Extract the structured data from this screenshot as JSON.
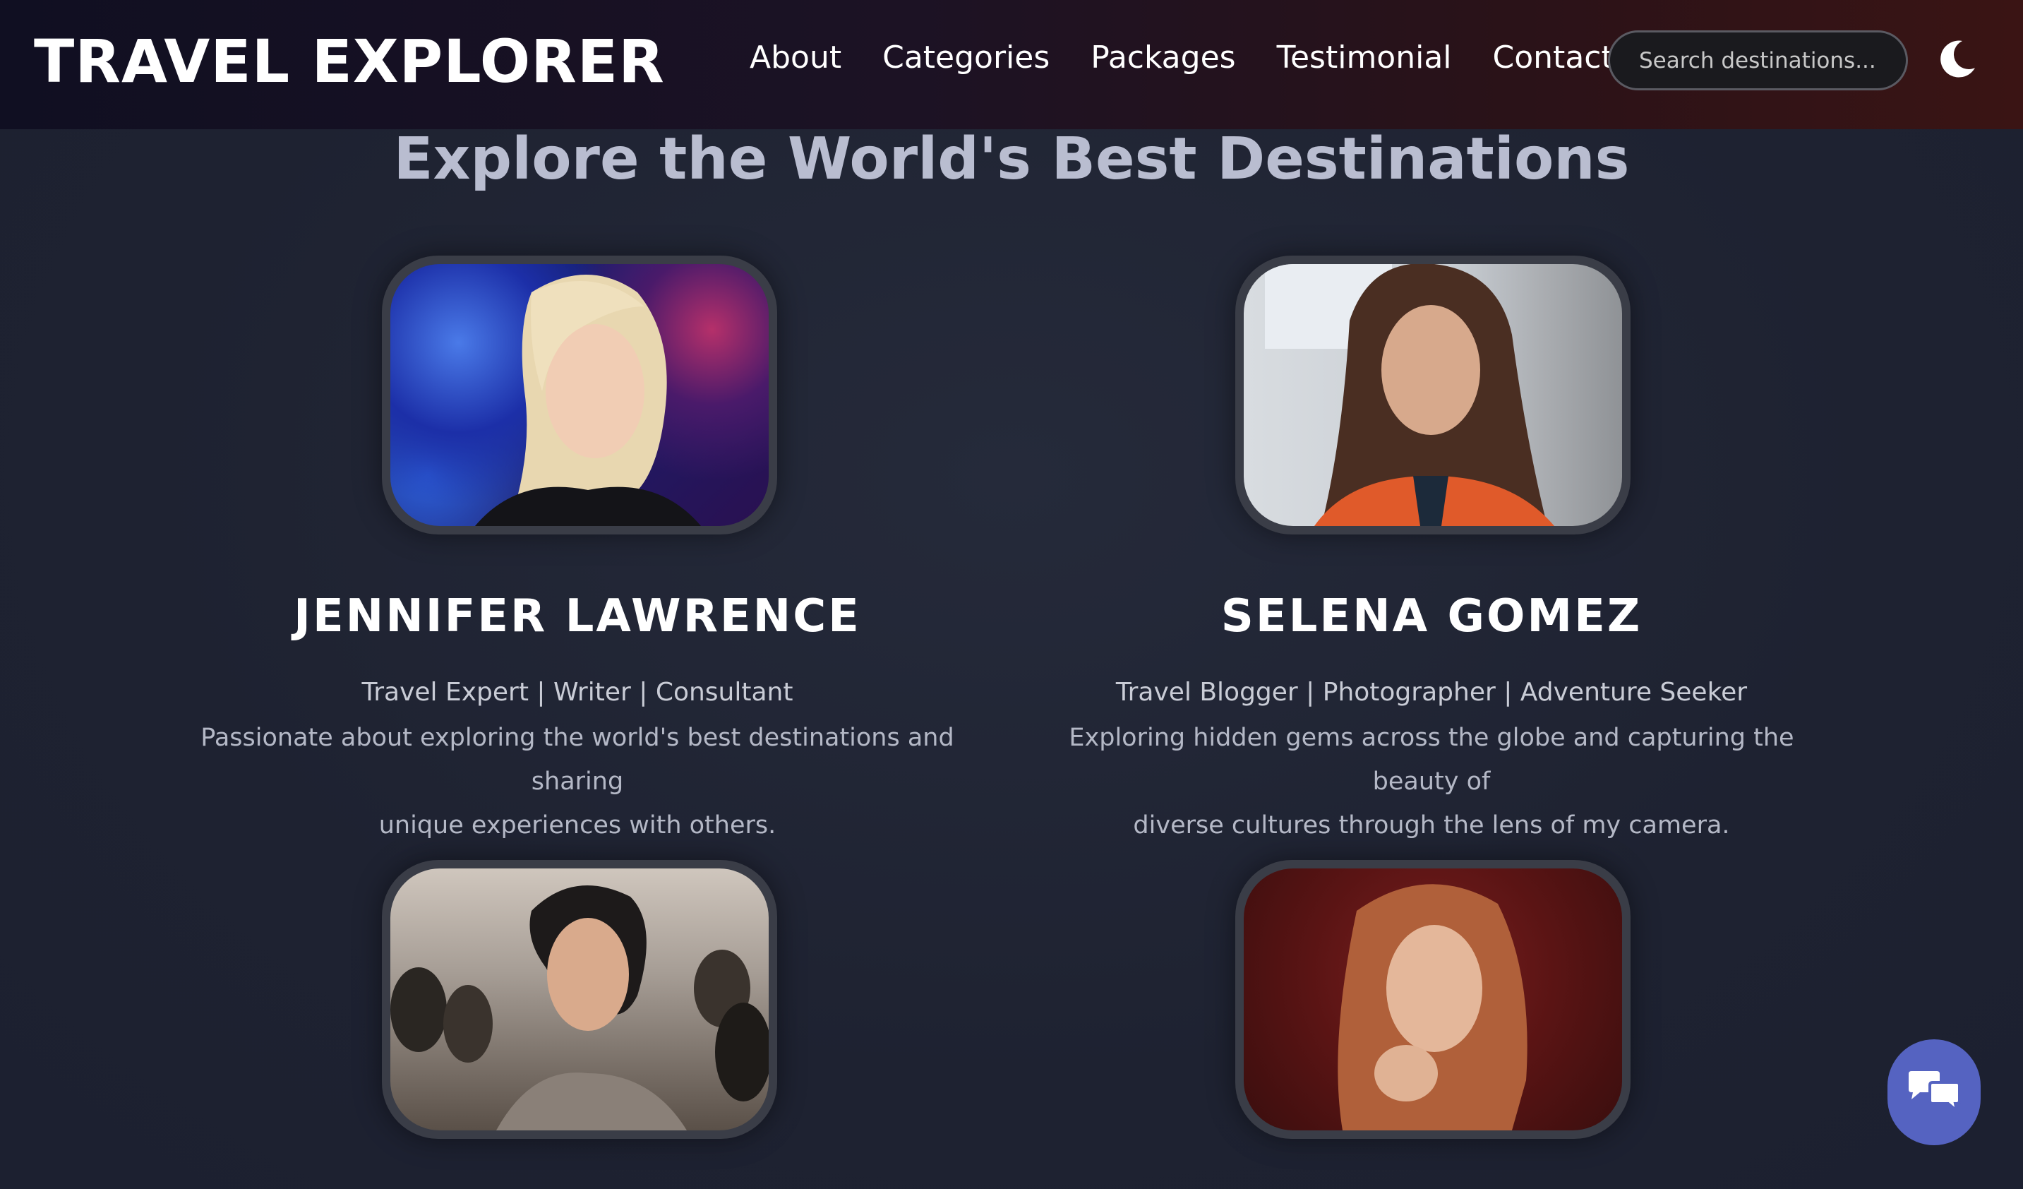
{
  "header": {
    "logo": "TRAVEL EXPLORER",
    "nav": [
      "About",
      "Categories",
      "Packages",
      "Testimonial",
      "Contact"
    ],
    "search_placeholder": "Search destinations...",
    "theme_icon": "moon-icon"
  },
  "main": {
    "title": "Explore the World's Best Destinations",
    "profiles": [
      {
        "name": "JENNIFER LAWRENCE",
        "role": "Travel Expert | Writer | Consultant",
        "bio_line1": "Passionate about exploring the world's best destinations and sharing",
        "bio_line2": "unique experiences with others."
      },
      {
        "name": "SELENA GOMEZ",
        "role": "Travel Blogger | Photographer | Adventure Seeker",
        "bio_line1": "Exploring hidden gems across the globe and capturing the beauty of",
        "bio_line2": "diverse cultures through the lens of my camera."
      },
      {
        "name": "",
        "role": "",
        "bio_line1": "",
        "bio_line2": ""
      },
      {
        "name": "",
        "role": "",
        "bio_line1": "",
        "bio_line2": ""
      }
    ]
  },
  "chat": {
    "icon": "chat-icon"
  },
  "colors": {
    "background": "#1f2433",
    "title": "#b9bdd0",
    "chat_button": "#5563c1"
  }
}
